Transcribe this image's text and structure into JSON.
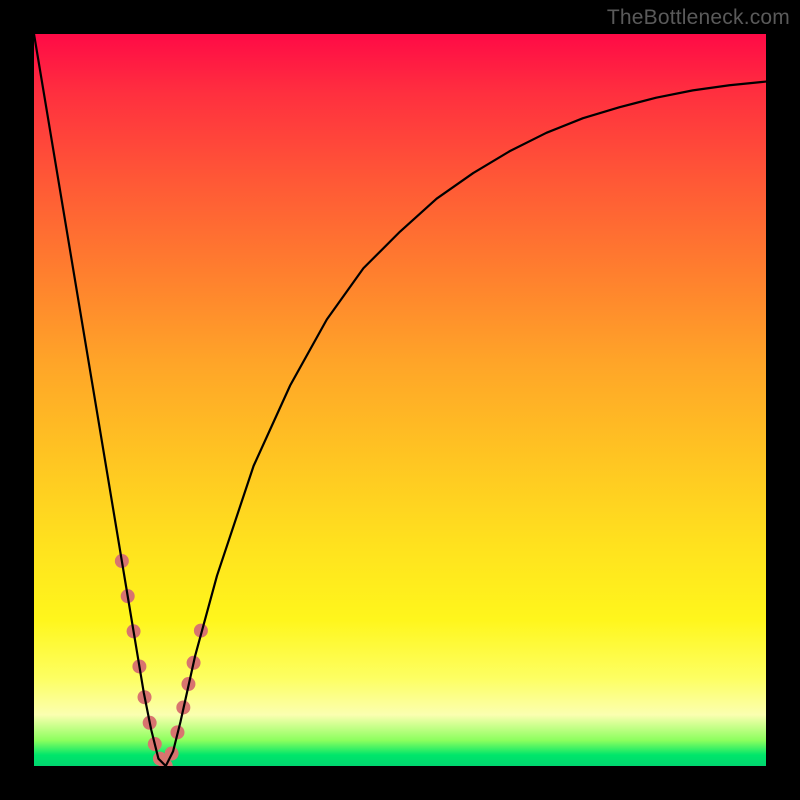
{
  "watermark": {
    "text": "TheBottleneck.com"
  },
  "chart_data": {
    "type": "line",
    "title": "",
    "xlabel": "",
    "ylabel": "",
    "xlim": [
      0,
      100
    ],
    "ylim": [
      0,
      100
    ],
    "grid": false,
    "legend": false,
    "series": [
      {
        "name": "bottleneck-curve",
        "x": [
          0,
          2,
          4,
          6,
          8,
          10,
          12,
          14,
          15,
          16,
          17,
          18,
          19,
          20,
          22,
          25,
          30,
          35,
          40,
          45,
          50,
          55,
          60,
          65,
          70,
          75,
          80,
          85,
          90,
          95,
          100
        ],
        "y": [
          100,
          88,
          76,
          64,
          52,
          40,
          28,
          16,
          10,
          5,
          1,
          0,
          2,
          6,
          15,
          26,
          41,
          52,
          61,
          68,
          73,
          77.5,
          81,
          84,
          86.5,
          88.5,
          90,
          91.3,
          92.3,
          93,
          93.5
        ],
        "note": "y is bottleneck percentage (0 best, 100 worst). Background color bands: ~0-4 green, ~4-12 pale, ~12-100 yellow→red. Minimum at x≈18."
      }
    ],
    "markers": {
      "name": "highlight-dots",
      "color": "#d8746f",
      "points_x": [
        12.0,
        12.8,
        13.6,
        14.4,
        15.1,
        15.8,
        16.5,
        17.2,
        18.0,
        18.8,
        19.6,
        20.4,
        21.1,
        21.8,
        22.8
      ],
      "points_y": [
        28.0,
        23.2,
        18.4,
        13.6,
        9.4,
        5.9,
        3.0,
        1.0,
        0.0,
        1.7,
        4.6,
        8.0,
        11.2,
        14.1,
        18.5
      ],
      "radius": 7
    }
  }
}
